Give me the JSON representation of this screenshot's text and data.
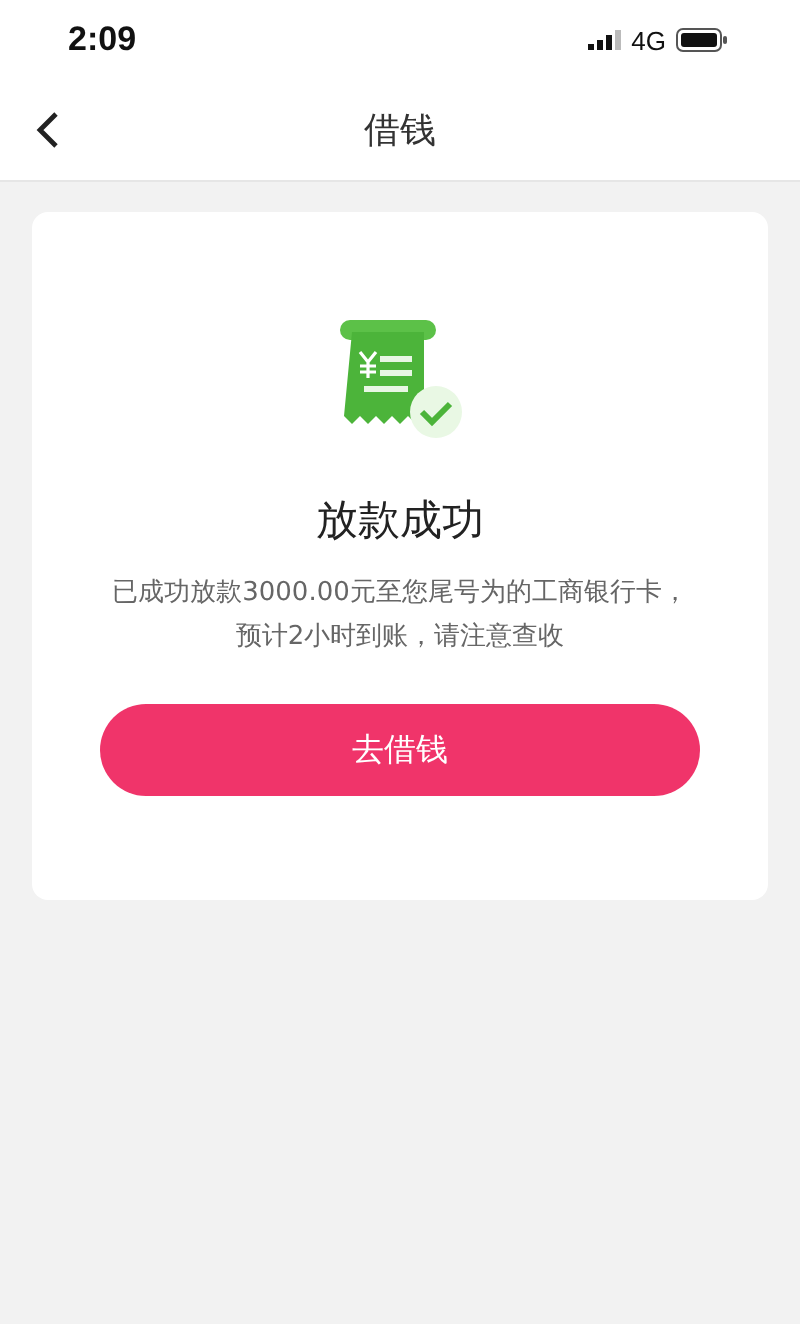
{
  "status_bar": {
    "time": "2:09",
    "network": "4G"
  },
  "nav": {
    "title": "借钱"
  },
  "result": {
    "title": "放款成功",
    "message": "已成功放款3000.00元至您尾号为的工商银行卡，预计2小时到账，请注意查收",
    "button": "去借钱"
  }
}
